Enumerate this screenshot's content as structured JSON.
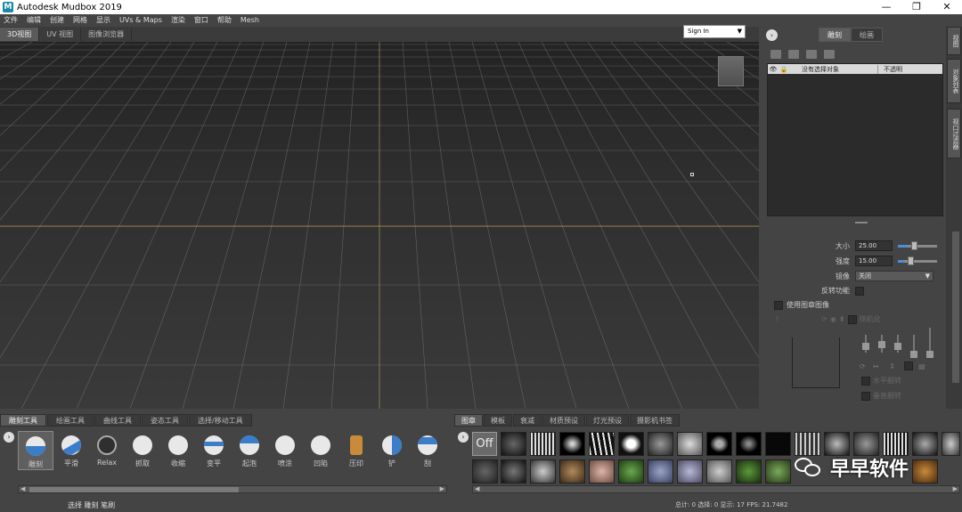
{
  "window": {
    "app_icon": "M",
    "title": "Autodesk Mudbox 2019",
    "controls": [
      "—",
      "❐",
      "✕"
    ]
  },
  "menu": [
    "文件",
    "编辑",
    "创建",
    "网格",
    "显示",
    "UVs & Maps",
    "渲染",
    "窗口",
    "帮助",
    "Mesh"
  ],
  "view_tabs": [
    {
      "label": "3D视图",
      "active": true
    },
    {
      "label": "UV 视图",
      "active": false
    },
    {
      "label": "图像浏览器",
      "active": false
    }
  ],
  "sign_in": {
    "label": "Sign In",
    "caret": "▼"
  },
  "right_panel": {
    "collapse_icon": "›",
    "tabs": [
      {
        "label": "雕刻",
        "active": true
      },
      {
        "label": "绘画",
        "active": false
      }
    ],
    "layer_header": {
      "eye": "👁",
      "lock": "🔒",
      "name": "没有选择对象",
      "opacity": "不透明"
    },
    "properties": {
      "size_label": "大小",
      "size_value": "25.00",
      "size_fraction": 0.25,
      "strength_label": "强度",
      "strength_value": "15.00",
      "strength_fraction": 0.15,
      "mirror_label": "镜像",
      "mirror_value": "关闭",
      "invert_label": "反转功能",
      "use_stamp_label": "使用图章图像",
      "randomize_label": "随机化",
      "flip_h_label": "水平翻转",
      "flip_v_label": "垂直翻转"
    },
    "strip_tabs": [
      "视图",
      "对象列表",
      "视口过滤器"
    ]
  },
  "tool_tray": {
    "tabs": [
      {
        "label": "雕刻工具",
        "active": true
      },
      {
        "label": "绘画工具",
        "active": false
      },
      {
        "label": "曲线工具",
        "active": false
      },
      {
        "label": "姿态工具",
        "active": false
      },
      {
        "label": "选择/移动工具",
        "active": false
      }
    ],
    "nav_icon": "›",
    "tools": [
      {
        "label": "雕刻",
        "active": true
      },
      {
        "label": "平滑",
        "active": false
      },
      {
        "label": "Relax",
        "active": false
      },
      {
        "label": "抓取",
        "active": false
      },
      {
        "label": "收缩",
        "active": false
      },
      {
        "label": "变平",
        "active": false
      },
      {
        "label": "起泡",
        "active": false
      },
      {
        "label": "喷涂",
        "active": false
      },
      {
        "label": "凹陷",
        "active": false
      },
      {
        "label": "压印",
        "active": false
      },
      {
        "label": "铲",
        "active": false
      },
      {
        "label": "刮",
        "active": false
      }
    ],
    "status": "选择 雕刻 笔刷"
  },
  "stamp_tray": {
    "tabs": [
      {
        "label": "图章",
        "active": true
      },
      {
        "label": "模板",
        "active": false
      },
      {
        "label": "衰减",
        "active": false
      },
      {
        "label": "材质预设",
        "active": false
      },
      {
        "label": "灯光预设",
        "active": false
      },
      {
        "label": "摄影机书签",
        "active": false
      }
    ],
    "nav_icon": "›",
    "off_label": "Off",
    "status": "总计: 0  选择: 0  显示: 17  FPS: 21.7482"
  },
  "watermark": "早早软件",
  "colors": {
    "accent": "#3a7dc9",
    "viewport_top": "#232323",
    "viewport_bottom": "#3a3a3a",
    "grid": "#8a8a8a",
    "axis": "#b8a14a"
  }
}
